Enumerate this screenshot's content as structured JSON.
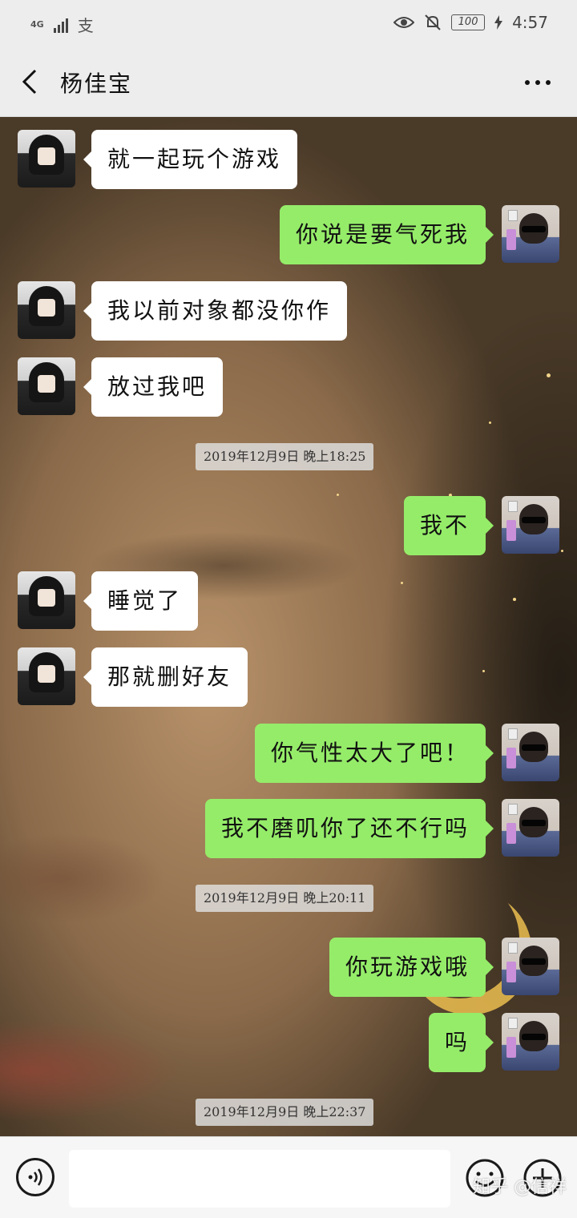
{
  "status_bar": {
    "network_label": "4G",
    "app_icon": "alipay-icon",
    "battery": "100",
    "time": "4:57"
  },
  "header": {
    "title": "杨佳宝",
    "back_icon": "back-chevron-icon",
    "more_icon": "more-dots-icon"
  },
  "messages": [
    {
      "side": "in",
      "text": "就一起玩个游戏"
    },
    {
      "side": "out",
      "text": "你说是要气死我"
    },
    {
      "side": "in",
      "text": "我以前对象都没你作"
    },
    {
      "side": "in",
      "text": "放过我吧"
    },
    {
      "side": "time",
      "text": "2019年12月9日 晚上18:25"
    },
    {
      "side": "out",
      "text": "我不"
    },
    {
      "side": "in",
      "text": "睡觉了"
    },
    {
      "side": "in",
      "text": "那就删好友"
    },
    {
      "side": "out",
      "text": "你气性太大了吧！"
    },
    {
      "side": "out",
      "text": "我不磨叽你了还不行吗"
    },
    {
      "side": "time",
      "text": "2019年12月9日 晚上20:11"
    },
    {
      "side": "out",
      "text": "你玩游戏哦"
    },
    {
      "side": "out",
      "text": "吗"
    },
    {
      "side": "time",
      "text": "2019年12月9日 晚上22:37"
    }
  ],
  "input_bar": {
    "voice_icon": "voice-icon",
    "placeholder": "",
    "emoji_icon": "emoji-icon",
    "plus_icon": "plus-icon"
  },
  "watermark": "知乎 @信祥",
  "colors": {
    "outgoing_bubble": "#95ec69",
    "incoming_bubble": "#ffffff",
    "bar_background": "#ededed"
  }
}
